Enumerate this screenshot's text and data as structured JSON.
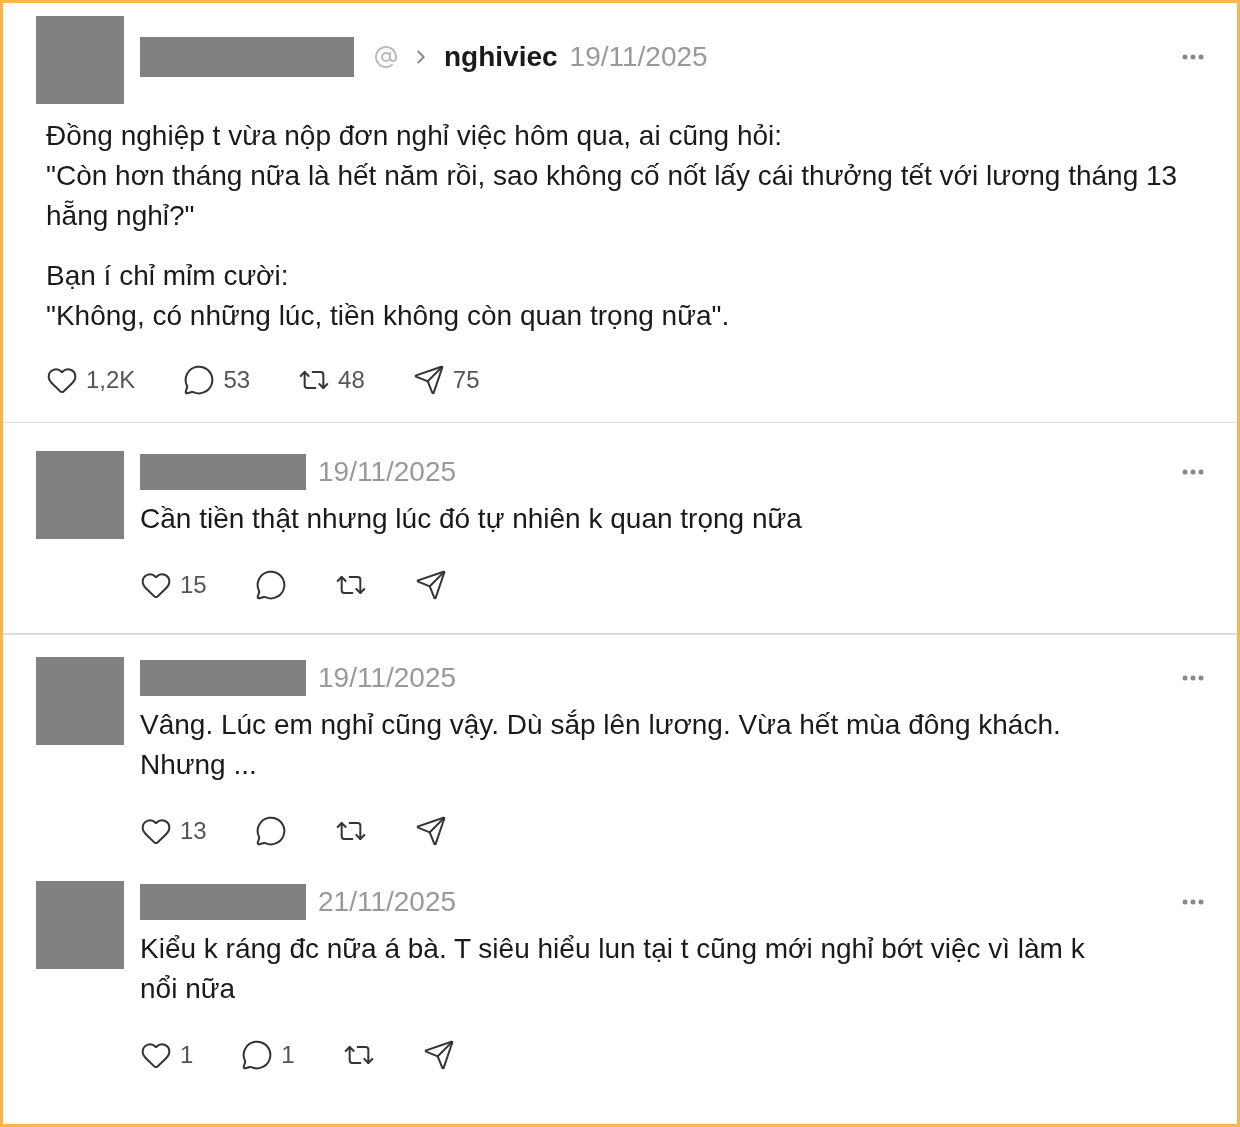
{
  "post": {
    "community": "nghiviec",
    "date": "19/11/2025",
    "paragraphs": [
      [
        "Đồng nghiệp t vừa nộp đơn nghỉ việc hôm qua, ai cũng hỏi:",
        "\"Còn hơn tháng nữa là hết năm rồi, sao không cố nốt lấy cái thưởng tết với lương tháng 13 hẵng nghỉ?\""
      ],
      [
        "Bạn í chỉ mỉm cười:",
        "\"Không, có những lúc, tiền không còn quan trọng nữa\"."
      ]
    ],
    "stats": [
      {
        "kind": "like",
        "count": "1,2K"
      },
      {
        "kind": "reply",
        "count": "53"
      },
      {
        "kind": "repost",
        "count": "48"
      },
      {
        "kind": "share",
        "count": "75"
      }
    ]
  },
  "replies": [
    {
      "date": "19/11/2025",
      "text": "Cần tiền thật nhưng lúc đó tự nhiên k quan trọng nữa",
      "divider": true,
      "stats": [
        {
          "kind": "like",
          "count": "15"
        },
        {
          "kind": "reply"
        },
        {
          "kind": "repost"
        },
        {
          "kind": "share"
        }
      ]
    },
    {
      "date": "19/11/2025",
      "text": "Vâng. Lúc em nghỉ cũng vậy. Dù sắp lên lương. Vừa hết mùa đông khách. Nhưng ...",
      "divider": false,
      "stats": [
        {
          "kind": "like",
          "count": "13"
        },
        {
          "kind": "reply"
        },
        {
          "kind": "repost"
        },
        {
          "kind": "share"
        }
      ]
    },
    {
      "date": "21/11/2025",
      "text": "Kiểu k ráng đc nữa á bà. T siêu hiểu lun tại t cũng mới nghỉ bớt việc vì làm k nổi nữa",
      "divider": false,
      "stats": [
        {
          "kind": "like",
          "count": "1"
        },
        {
          "kind": "reply",
          "count": "1"
        },
        {
          "kind": "repost"
        },
        {
          "kind": "share"
        }
      ]
    }
  ]
}
